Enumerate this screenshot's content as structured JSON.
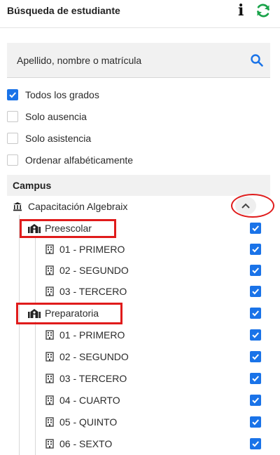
{
  "header": {
    "title": "Búsqueda de estudiante",
    "info_icon": "info-icon",
    "refresh_icon": "refresh-icon",
    "refresh_color": "#1aa34a"
  },
  "search": {
    "placeholder": "Apellido, nombre o matrícula",
    "value": ""
  },
  "options": [
    {
      "label": "Todos los grados",
      "checked": true
    },
    {
      "label": "Solo ausencia",
      "checked": false
    },
    {
      "label": "Solo asistencia",
      "checked": false
    },
    {
      "label": "Ordenar alfabéticamente",
      "checked": false
    }
  ],
  "campus": {
    "heading": "Campus",
    "name": "Capacitación Algebraix",
    "expanded": true,
    "schools": [
      {
        "name": "Preescolar",
        "checked": true,
        "highlighted": true,
        "grades": [
          {
            "label": "01 - PRIMERO",
            "checked": true
          },
          {
            "label": "02 - SEGUNDO",
            "checked": true
          },
          {
            "label": "03 - TERCERO",
            "checked": true
          }
        ]
      },
      {
        "name": "Preparatoria",
        "checked": true,
        "highlighted": true,
        "grades": [
          {
            "label": "01 - PRIMERO",
            "checked": true
          },
          {
            "label": "02 - SEGUNDO",
            "checked": true
          },
          {
            "label": "03 - TERCERO",
            "checked": true
          },
          {
            "label": "04 - CUARTO",
            "checked": true
          },
          {
            "label": "05 - QUINTO",
            "checked": true
          },
          {
            "label": "06 - SEXTO",
            "checked": true
          }
        ]
      }
    ]
  },
  "colors": {
    "accent": "#1a73e8",
    "annotation": "#e01b1b",
    "panel_bg": "#f1f1f1"
  }
}
